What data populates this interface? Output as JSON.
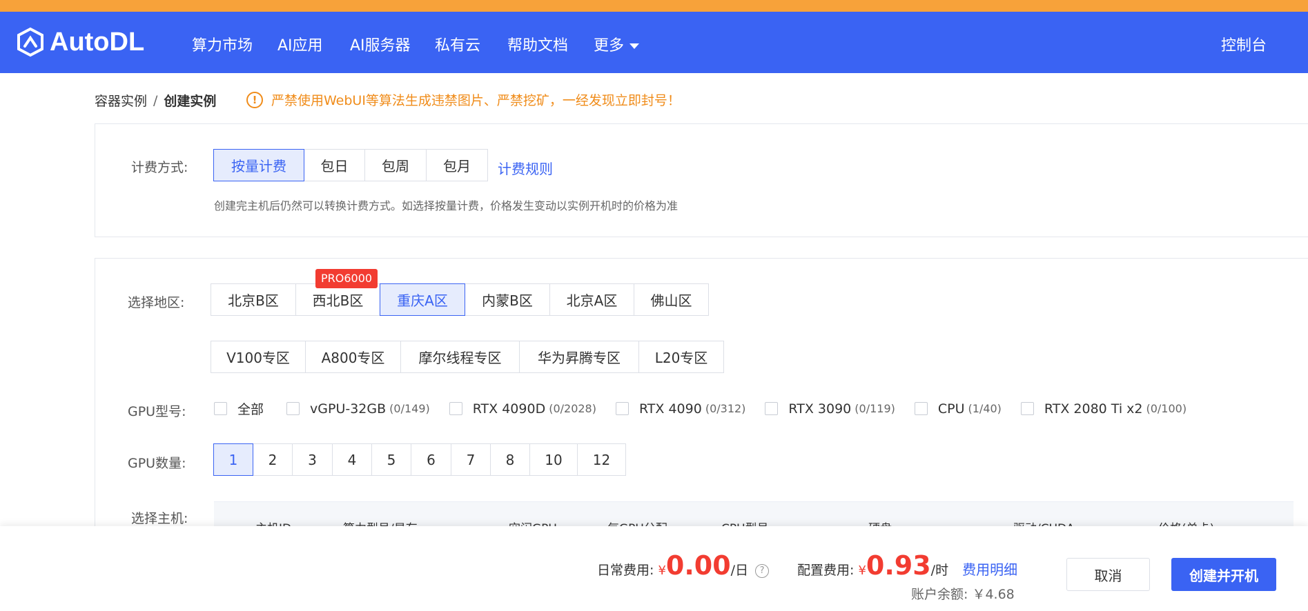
{
  "brand": {
    "name": "AutoDL",
    "primary_color": "#3a63f3",
    "warning_color": "#f08c1a",
    "price_color": "#f23c31"
  },
  "nav": {
    "items": [
      "算力市场",
      "AI应用",
      "AI服务器",
      "私有云",
      "帮助文档",
      "更多"
    ],
    "console": "控制台"
  },
  "breadcrumb": {
    "parent": "容器实例",
    "separator": "/",
    "current": "创建实例"
  },
  "warning": {
    "icon": "exclamation-icon",
    "text": "严禁使用WebUI等算法生成违禁图片、严禁挖矿，一经发现立即封号！"
  },
  "billing": {
    "label": "计费方式:",
    "options": [
      "按量计费",
      "包日",
      "包周",
      "包月"
    ],
    "selected": "按量计费",
    "rules_link": "计费规则",
    "hint": "创建完主机后仍然可以转换计费方式。如选择按量计费，价格发生变动以实例开机时的价格为准"
  },
  "region": {
    "label": "选择地区:",
    "row1": [
      "北京B区",
      "西北B区",
      "重庆A区",
      "内蒙B区",
      "北京A区",
      "佛山区"
    ],
    "row2": [
      "V100专区",
      "A800专区",
      "摩尔线程专区",
      "华为昇腾专区",
      "L20专区"
    ],
    "selected": "重庆A区",
    "tag": "PRO6000"
  },
  "gpu_model": {
    "label": "GPU型号:",
    "options": [
      {
        "name": "全部",
        "count": ""
      },
      {
        "name": "vGPU-32GB",
        "count": "(0/149)"
      },
      {
        "name": "RTX 4090D",
        "count": "(0/2028)"
      },
      {
        "name": "RTX 4090",
        "count": "(0/312)"
      },
      {
        "name": "RTX 3090",
        "count": "(0/119)"
      },
      {
        "name": "CPU",
        "count": "(1/40)"
      },
      {
        "name": "RTX 2080 Ti x2",
        "count": "(0/100)"
      }
    ]
  },
  "gpu_count": {
    "label": "GPU数量:",
    "options": [
      "1",
      "2",
      "3",
      "4",
      "5",
      "6",
      "7",
      "8",
      "10",
      "12"
    ],
    "selected": "1"
  },
  "host": {
    "label": "选择主机:",
    "columns": [
      "主机ID",
      "算力型号/显存",
      "空闲GPU",
      "每GPU分配",
      "CPU型号",
      "硬盘",
      "驱动/CUDA",
      "价格(单卡)"
    ]
  },
  "footer": {
    "daily_label": "日常费用:",
    "daily_currency": "¥",
    "daily_value": "0.00",
    "daily_unit": "/日",
    "config_label": "配置费用:",
    "config_currency": "¥",
    "config_value": "0.93",
    "config_unit": "/时",
    "detail_link": "费用明细",
    "balance_label": "账户余额:",
    "balance_value": "￥4.68",
    "cancel": "取消",
    "create": "创建并开机"
  }
}
